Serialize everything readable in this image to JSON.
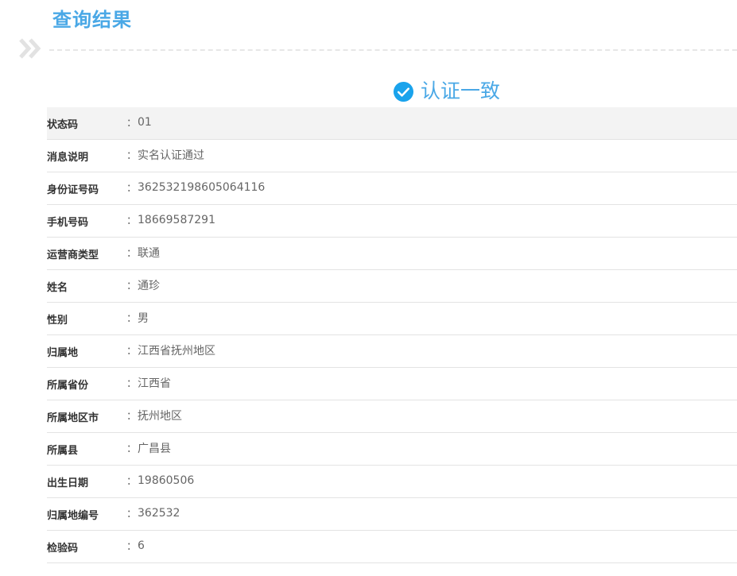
{
  "header": {
    "title": "查询结果"
  },
  "result": {
    "status_text": "认证一致",
    "accent_color": "#4aa8e6"
  },
  "icons": {
    "chevron": "double-chevron-right",
    "check": "check-circle"
  },
  "rows": [
    {
      "label": "状态码",
      "colon": "：",
      "value": "01"
    },
    {
      "label": "消息说明",
      "colon": "：",
      "value": "实名认证通过"
    },
    {
      "label": "身份证号码",
      "colon": "：",
      "value": "362532198605064116"
    },
    {
      "label": "手机号码",
      "colon": "：",
      "value": "18669587291"
    },
    {
      "label": "运营商类型",
      "colon": "：",
      "value": "联通"
    },
    {
      "label": "姓名",
      "colon": "：",
      "value": "通珍"
    },
    {
      "label": "性别",
      "colon": "：",
      "value": "男"
    },
    {
      "label": "归属地",
      "colon": "：",
      "value": "江西省抚州地区"
    },
    {
      "label": "所属省份",
      "colon": "：",
      "value": "江西省"
    },
    {
      "label": "所属地区市",
      "colon": "：",
      "value": "抚州地区"
    },
    {
      "label": "所属县",
      "colon": "：",
      "value": "广昌县"
    },
    {
      "label": "出生日期",
      "colon": "：",
      "value": "19860506"
    },
    {
      "label": "归属地编号",
      "colon": "：",
      "value": "362532"
    },
    {
      "label": "检验码",
      "colon": "：",
      "value": "6"
    }
  ]
}
